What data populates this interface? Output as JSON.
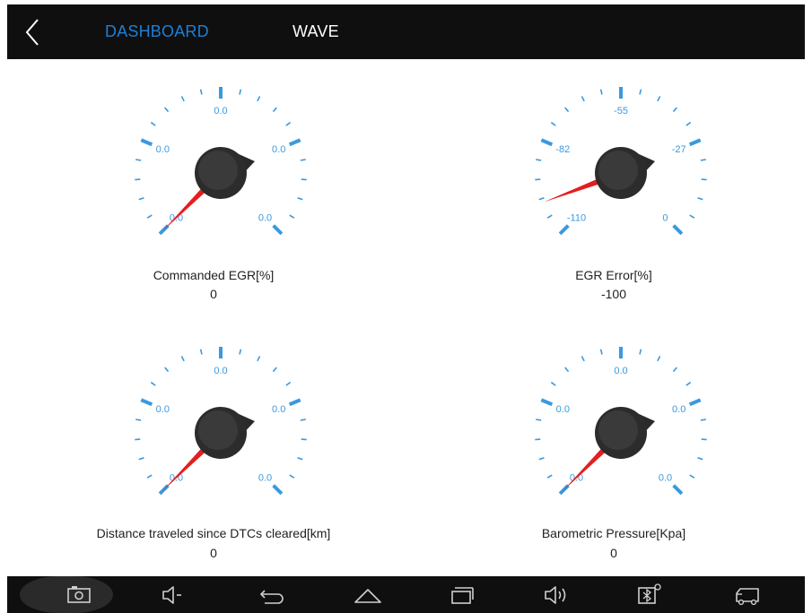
{
  "tabs": {
    "dashboard": "DASHBOARD",
    "wave": "WAVE"
  },
  "colors": {
    "accent": "#1f7fd6",
    "tick": "#3b99de",
    "needle": "#e41e1e",
    "bar": "#0f0f0f"
  },
  "gauges": [
    {
      "label": "Commanded EGR[%]",
      "value": "0",
      "ticks": {
        "min": "0.0",
        "low": "0.0",
        "mid": "0.0",
        "high": "0.0",
        "max": "0.0"
      },
      "needle_fraction": 0
    },
    {
      "label": "EGR Error[%]",
      "value": "-100",
      "ticks": {
        "min": "-110",
        "low": "-82",
        "mid": "-55",
        "high": "-27",
        "max": "0"
      },
      "needle_fraction": 0.09
    },
    {
      "label": "Distance traveled since DTCs cleared[km]",
      "value": "0",
      "ticks": {
        "min": "0.0",
        "low": "0.0",
        "mid": "0.0",
        "high": "0.0",
        "max": "0.0"
      },
      "needle_fraction": 0
    },
    {
      "label": "Barometric Pressure[Kpa]",
      "value": "0",
      "ticks": {
        "min": "0.0",
        "low": "0.0",
        "mid": "0.0",
        "high": "0.0",
        "max": "0.0"
      },
      "needle_fraction": 0
    }
  ],
  "navbar": {
    "icons": [
      "camera-icon",
      "volume-down-icon",
      "back-icon",
      "home-icon",
      "recent-apps-icon",
      "volume-up-icon",
      "bluetooth-vci-icon",
      "truck-icon"
    ]
  }
}
